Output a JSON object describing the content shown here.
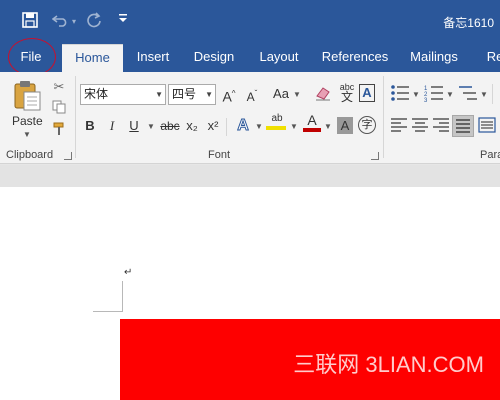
{
  "window": {
    "title": "备忘1610"
  },
  "quick_access": {
    "save_icon": "save-icon",
    "undo_icon": "undo-icon",
    "redo_icon": "redo-icon",
    "customize_icon": "customize-qat-icon"
  },
  "tabs": [
    {
      "label": "File",
      "active": false
    },
    {
      "label": "Home",
      "active": true
    },
    {
      "label": "Insert",
      "active": false
    },
    {
      "label": "Design",
      "active": false
    },
    {
      "label": "Layout",
      "active": false
    },
    {
      "label": "References",
      "active": false
    },
    {
      "label": "Mailings",
      "active": false
    },
    {
      "label": "Re",
      "active": false
    }
  ],
  "clipboard": {
    "paste_label": "Paste",
    "group_label": "Clipboard"
  },
  "font": {
    "font_name": "宋体",
    "font_size": "四号",
    "group_label": "Font",
    "change_case_label": "Aa",
    "bold": "B",
    "italic": "I",
    "underline": "U",
    "strikethrough": "abc",
    "subscript": "x₂",
    "superscript": "x²",
    "grow_font": "A",
    "shrink_font": "A",
    "text_effects": "A",
    "font_color": "A",
    "char_shading": "A",
    "enclose_char": "字",
    "highlight_label": "ab",
    "phonetic_label": "abc",
    "border_label": "A"
  },
  "paragraph": {
    "group_label": "Para"
  },
  "document": {
    "paragraph_mark": "↵"
  },
  "watermark": {
    "text": "三联网 3LIAN.COM"
  },
  "colors": {
    "accent": "#2b579a",
    "ribbon_bg": "#f3f3f3",
    "red_shape": "#fe0000",
    "highlight": "#f0e000",
    "font_color_bar": "#c00000"
  }
}
